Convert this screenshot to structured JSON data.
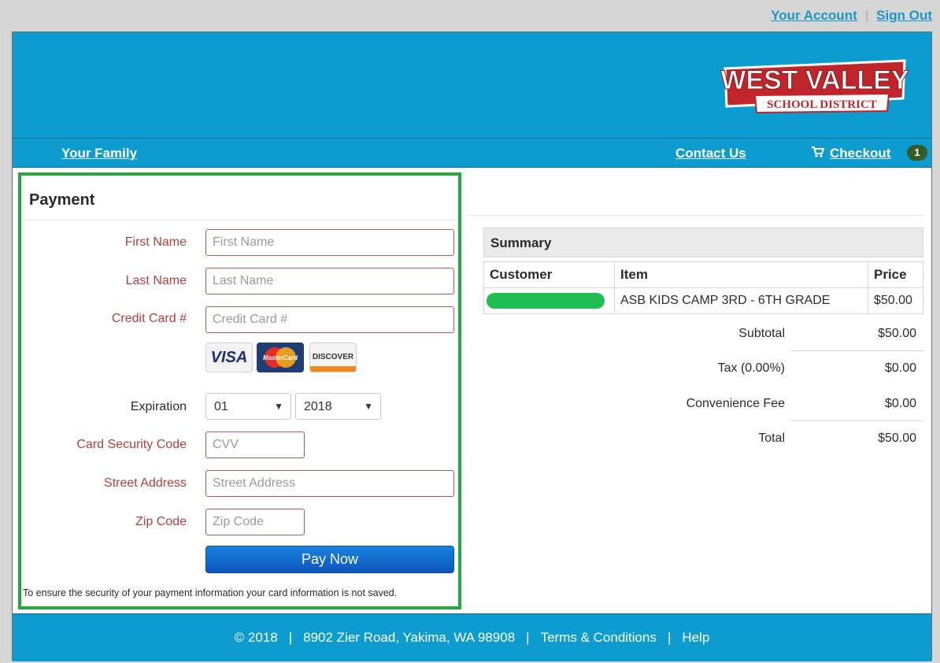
{
  "top_links": {
    "account": "Your Account",
    "separator": "|",
    "sign_out": "Sign Out"
  },
  "logo": {
    "line1": "WEST VALLEY",
    "line2": "SCHOOL DISTRICT"
  },
  "nav": {
    "family": "Your Family",
    "contact": "Contact Us",
    "checkout": "Checkout",
    "cart_count": "1"
  },
  "payment": {
    "title": "Payment",
    "first_name": {
      "label": "First Name",
      "placeholder": "First Name",
      "value": ""
    },
    "last_name": {
      "label": "Last Name",
      "placeholder": "Last Name",
      "value": ""
    },
    "card_number": {
      "label": "Credit Card #",
      "placeholder": "Credit Card #",
      "value": ""
    },
    "cards": {
      "visa": "VISA",
      "mastercard": "MasterCard",
      "discover": "DISCOVER"
    },
    "expiration": {
      "label": "Expiration",
      "month": "01",
      "year": "2018"
    },
    "cvv": {
      "label": "Card Security Code",
      "placeholder": "CVV",
      "value": ""
    },
    "street": {
      "label": "Street Address",
      "placeholder": "Street Address",
      "value": ""
    },
    "zip": {
      "label": "Zip Code",
      "placeholder": "Zip Code",
      "value": ""
    },
    "pay_button": "Pay Now",
    "note": "To ensure the security of your payment information your card information is not saved."
  },
  "summary": {
    "title": "Summary",
    "columns": [
      "Customer",
      "Item",
      "Price"
    ],
    "rows": [
      {
        "customer": "",
        "item": "ASB KIDS CAMP 3RD - 6TH GRADE",
        "price": "$50.00"
      }
    ],
    "subtotal": {
      "label": "Subtotal",
      "value": "$50.00"
    },
    "tax": {
      "label": "Tax (0.00%)",
      "value": "$0.00"
    },
    "fee": {
      "label": "Convenience Fee",
      "value": "$0.00"
    },
    "total": {
      "label": "Total",
      "value": "$50.00"
    }
  },
  "footer": {
    "copyright": "© 2018",
    "address": "8902 Zier Road, Yakima, WA 98908",
    "terms": "Terms & Conditions",
    "help": "Help",
    "separator": "|"
  },
  "colors": {
    "brand_blue": "#0d9ccf",
    "highlight_green": "#27a744",
    "label_red": "#b1403d",
    "button_blue": "#0a56bb",
    "logo_red": "#c0252b"
  }
}
